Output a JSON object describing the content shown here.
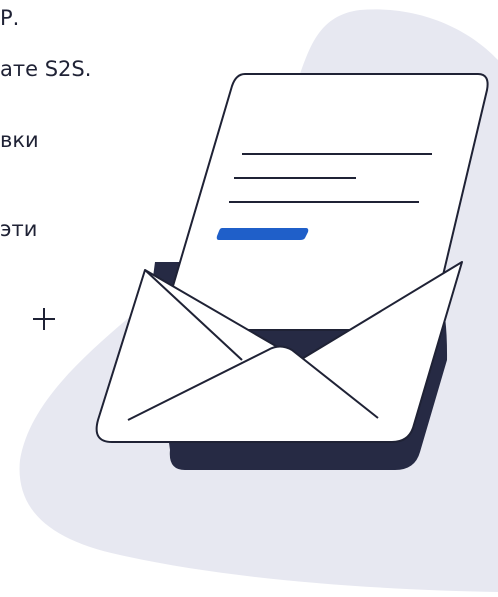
{
  "text_fragments": [
    "Р.",
    "ате S2S.",
    "вки",
    "эти"
  ],
  "icons": {
    "plus": "plus-icon",
    "illustration": "envelope-with-letter-illustration"
  },
  "colors": {
    "text": "#1f2235",
    "blob": "#e7e8f1",
    "envelope_shadow": "#262a44",
    "letter_button": "#1f5fc9",
    "outline": "#1f2235"
  }
}
